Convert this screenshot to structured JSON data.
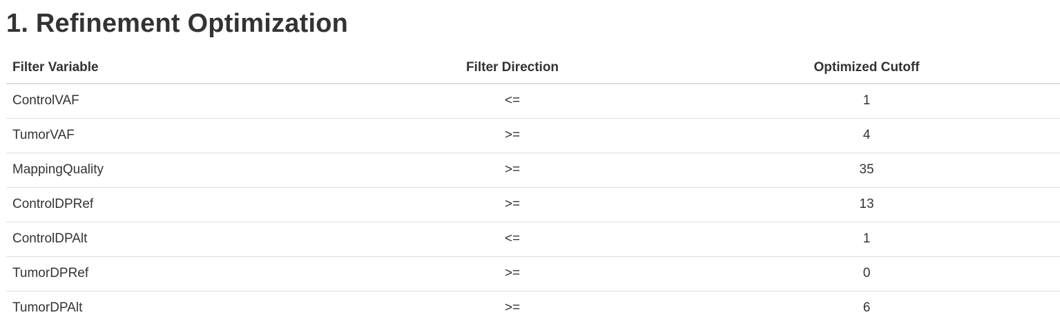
{
  "title": "1. Refinement Optimization",
  "table": {
    "headers": [
      "Filter Variable",
      "Filter Direction",
      "Optimized Cutoff"
    ],
    "rows": [
      [
        "ControlVAF",
        "<=",
        "1"
      ],
      [
        "TumorVAF",
        ">=",
        "4"
      ],
      [
        "MappingQuality",
        ">=",
        "35"
      ],
      [
        "ControlDPRef",
        ">=",
        "13"
      ],
      [
        "ControlDPAlt",
        "<=",
        "1"
      ],
      [
        "TumorDPRef",
        ">=",
        "0"
      ],
      [
        "TumorDPAlt",
        ">=",
        "6"
      ]
    ]
  }
}
